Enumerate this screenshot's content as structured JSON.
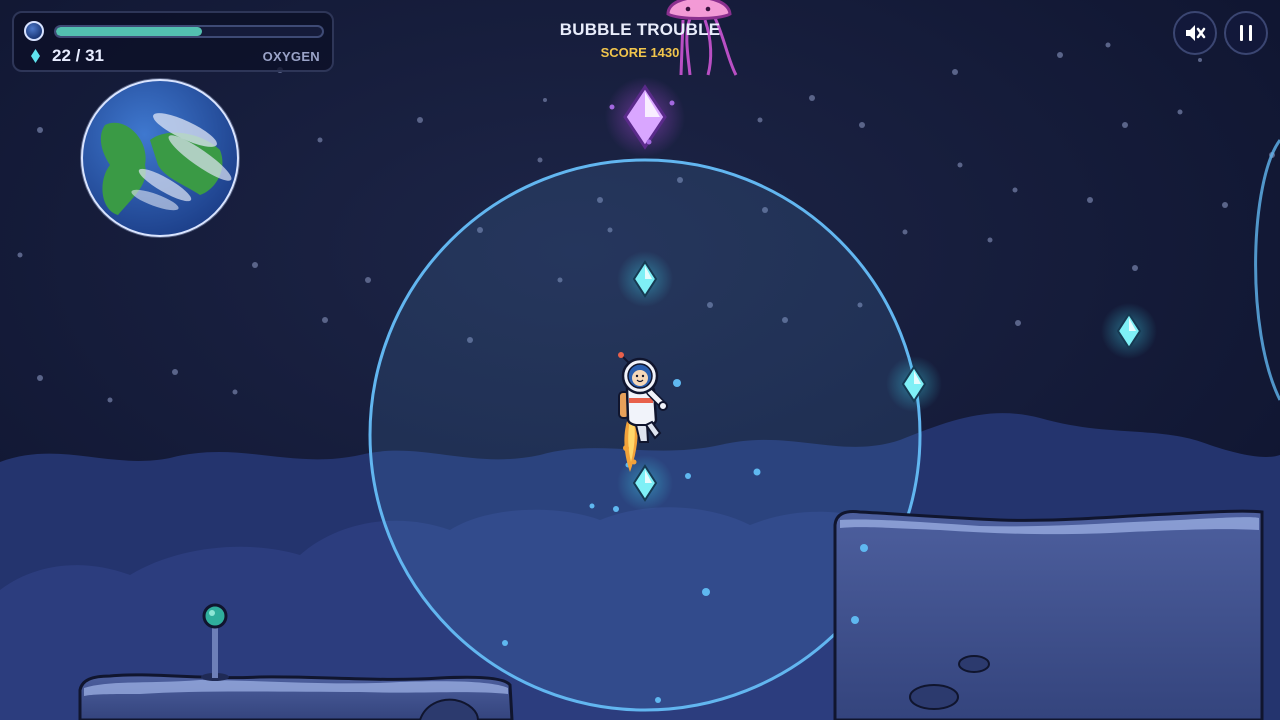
{
  "hud": {
    "oxygen_level": 0.55,
    "gems_collected": "22 / 31",
    "oxygen_label": "OXYGEN",
    "icons": [
      "planet-orb-icon",
      "gem-icon"
    ]
  },
  "game": {
    "title": "BUBBLE TROUBLE",
    "score": "SCORE 1430"
  },
  "controls": {
    "buttons": [
      "mute-icon",
      "pause-icon"
    ]
  },
  "colors": {
    "oxygen_bar": "#53c0b0",
    "gem": "#5fe3ef",
    "score": "#f1c54c",
    "bubble": "#62b6f0",
    "jellyfish": "#f39ad6"
  }
}
